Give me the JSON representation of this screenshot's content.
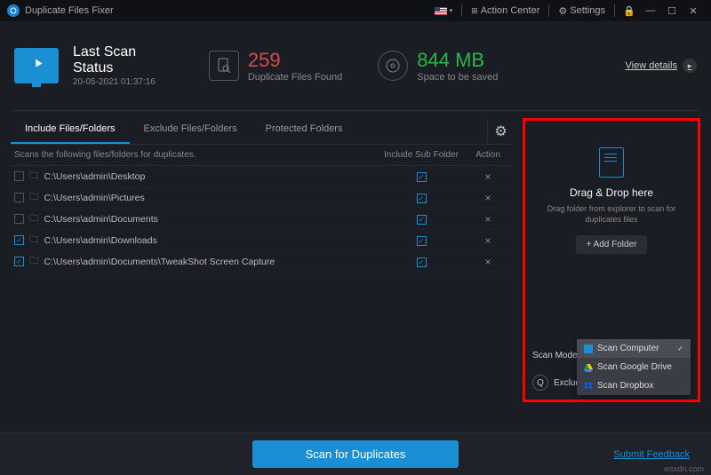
{
  "titlebar": {
    "app_name": "Duplicate Files Fixer",
    "action_center": "Action Center",
    "settings": "Settings"
  },
  "summary": {
    "status_line1": "Last Scan",
    "status_line2": "Status",
    "timestamp": "20-05-2021 01:37:16",
    "dup_count": "259",
    "dup_label": "Duplicate Files Found",
    "space_value": "844 MB",
    "space_label": "Space to be saved",
    "view_details": "View details"
  },
  "tabs": {
    "include": "Include Files/Folders",
    "exclude": "Exclude Files/Folders",
    "protected": "Protected Folders"
  },
  "table": {
    "header_desc": "Scans the following files/folders for duplicates.",
    "header_sub": "Include Sub Folder",
    "header_action": "Action",
    "rows": [
      {
        "path": "C:\\Users\\admin\\Desktop",
        "checked": false,
        "sub": true
      },
      {
        "path": "C:\\Users\\admin\\Pictures",
        "checked": false,
        "sub": true
      },
      {
        "path": "C:\\Users\\admin\\Documents",
        "checked": false,
        "sub": true
      },
      {
        "path": "C:\\Users\\admin\\Downloads",
        "checked": true,
        "sub": true
      },
      {
        "path": "C:\\Users\\admin\\Documents\\TweakShot Screen Capture",
        "checked": true,
        "sub": true
      }
    ]
  },
  "right": {
    "drop_title": "Drag & Drop here",
    "drop_sub": "Drag folder from explorer to scan for duplicates files",
    "add_folder": "+ Add Folder",
    "scan_mode_label": "Scan Mode",
    "scan_mode_selected": "Scan Computer",
    "exclude_label": "Exclude Fo",
    "dropdown": [
      "Scan Computer",
      "Scan Google Drive",
      "Scan Dropbox"
    ]
  },
  "bottom": {
    "scan_btn": "Scan for Duplicates",
    "feedback": "Submit Feedback"
  },
  "watermark": "wsxdn.com"
}
